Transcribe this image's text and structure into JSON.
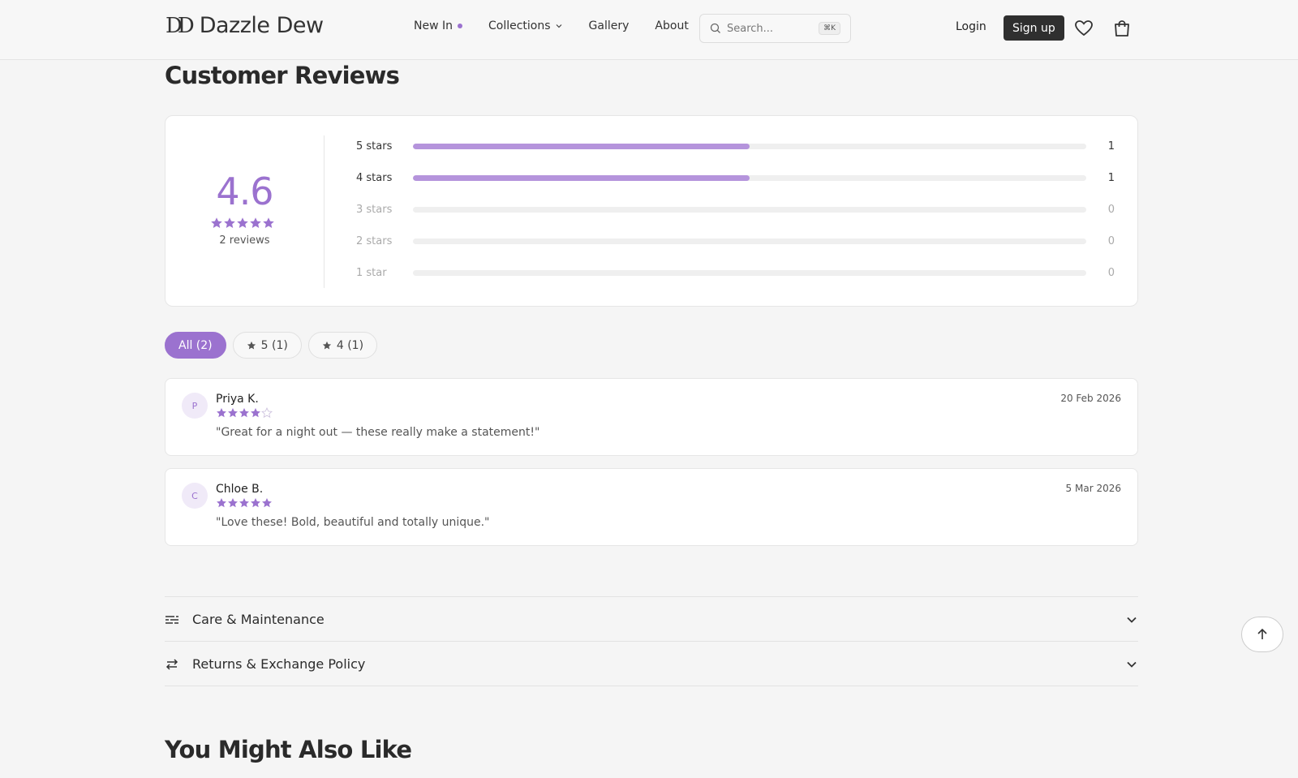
{
  "header": {
    "logo_mark": "DD",
    "logo_text": "Dazzle Dew",
    "nav": [
      {
        "label": "New In"
      },
      {
        "label": "Collections"
      },
      {
        "label": "Gallery"
      },
      {
        "label": "About"
      }
    ],
    "search_placeholder": "Search...",
    "search_shortcut": "⌘K",
    "login_label": "Login",
    "signup_label": "Sign up"
  },
  "reviews_title": "Customer Reviews",
  "summary": {
    "average": "4.6",
    "stars_filled": 5,
    "count_label": "2 reviews",
    "rows": [
      {
        "label": "5 stars",
        "count": "1",
        "fraction": 0.5
      },
      {
        "label": "4 stars",
        "count": "1",
        "fraction": 0.5
      },
      {
        "label": "3 stars",
        "count": "0",
        "fraction": 0
      },
      {
        "label": "2 stars",
        "count": "0",
        "fraction": 0
      },
      {
        "label": "1 star",
        "count": "0",
        "fraction": 0
      }
    ]
  },
  "filters": [
    {
      "label": "All (2)",
      "active": true
    },
    {
      "label": "5 (1)",
      "active": false
    },
    {
      "label": "4 (1)",
      "active": false
    }
  ],
  "reviews": [
    {
      "initial": "P",
      "name": "Priya K.",
      "rating": 4,
      "text": "\"Great for a night out — these really make a statement!\"",
      "date": "20 Feb 2026"
    },
    {
      "initial": "C",
      "name": "Chloe B.",
      "rating": 5,
      "text": "\"Love these! Bold, beautiful and totally unique.\"",
      "date": "5 Mar 2026"
    }
  ],
  "accordions": [
    {
      "label": "Care & Maintenance",
      "icon": "filter-lines-icon"
    },
    {
      "label": "Returns & Exchange Policy",
      "icon": "swap-arrows-icon"
    }
  ],
  "also_like_title": "You Might Also Like",
  "colors": {
    "accent": "#9b72cf",
    "bar_fill": "#b594dc",
    "signup_bg": "#2f2f2f"
  }
}
